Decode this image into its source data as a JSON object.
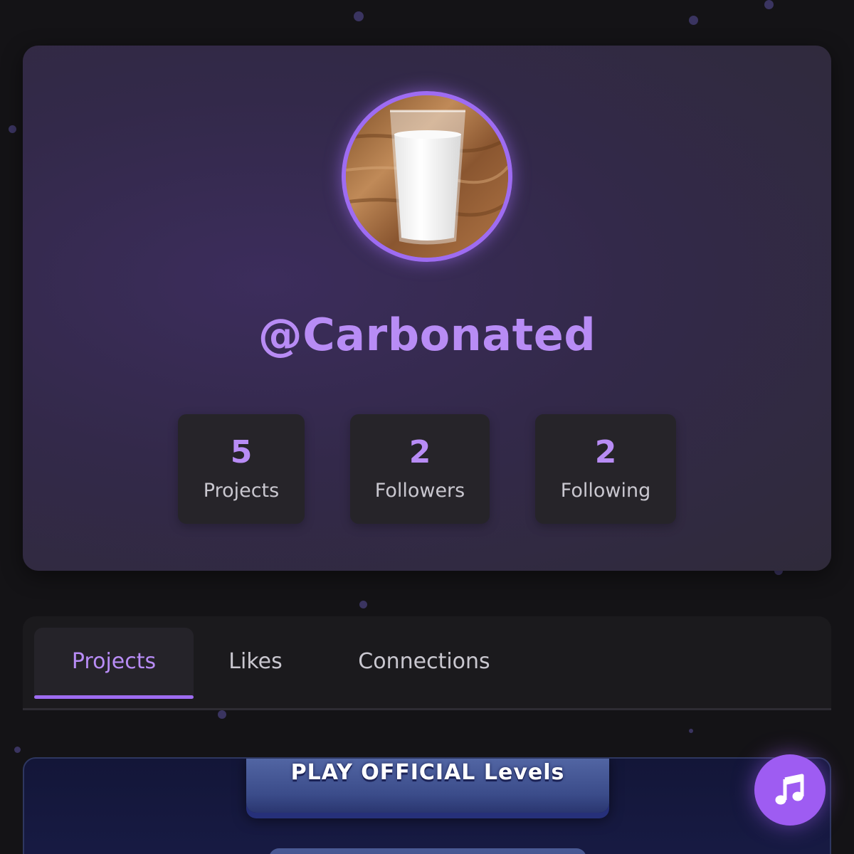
{
  "profile": {
    "username": "@Carbonated",
    "avatar_icon": "glass-of-milk"
  },
  "stats": [
    {
      "value": "5",
      "label": "Projects"
    },
    {
      "value": "2",
      "label": "Followers"
    },
    {
      "value": "2",
      "label": "Following"
    }
  ],
  "tabs": [
    {
      "label": "Projects",
      "active": true
    },
    {
      "label": "Likes",
      "active": false
    },
    {
      "label": "Connections",
      "active": false
    }
  ],
  "project_preview": {
    "button_text": "PLAY OFFICIAL Levels"
  },
  "fab": {
    "icon": "music-note-icon"
  },
  "colors": {
    "accent": "#9e6cf2",
    "accent_text": "#b88cf5",
    "background": "#141316",
    "card": "#2f2a3a"
  }
}
